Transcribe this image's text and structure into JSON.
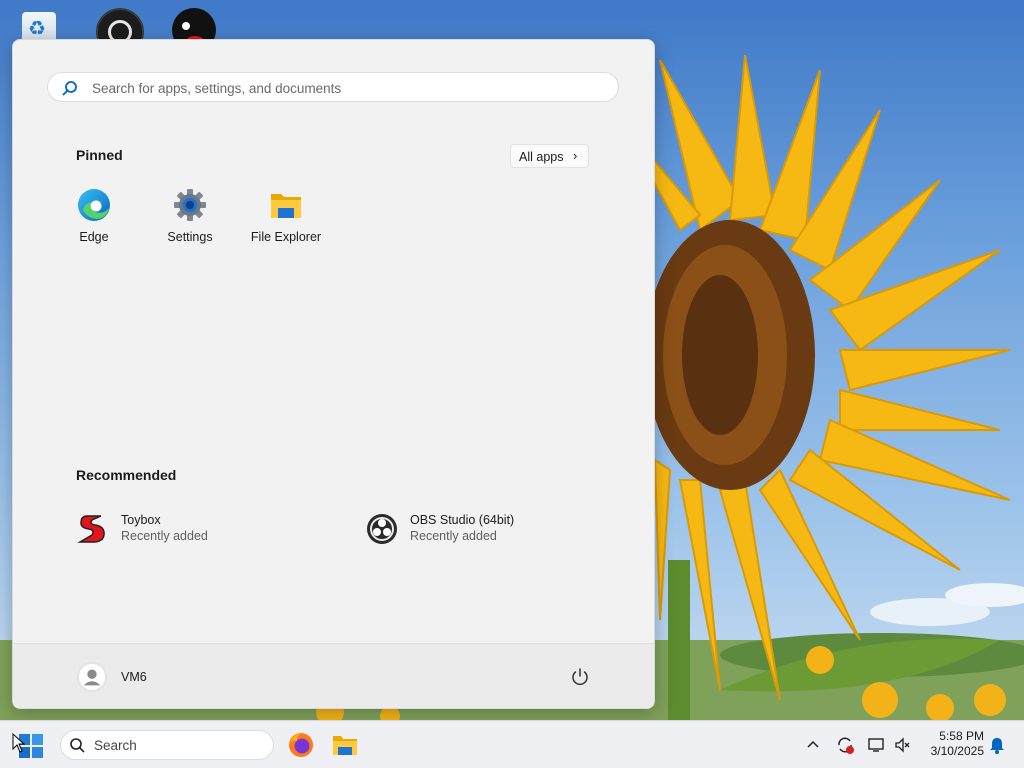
{
  "desktop": {
    "icons": [
      {
        "name": "recycle-bin-icon"
      },
      {
        "name": "obs-studio-icon"
      },
      {
        "name": "toybox-penguin-icon"
      }
    ]
  },
  "start_menu": {
    "search": {
      "placeholder": "Search for apps, settings, and documents"
    },
    "pinned": {
      "title": "Pinned",
      "all_apps_label": "All apps",
      "apps": [
        {
          "label": "Edge",
          "icon": "edge-icon"
        },
        {
          "label": "Settings",
          "icon": "settings-gear-icon"
        },
        {
          "label": "File Explorer",
          "icon": "folder-icon"
        }
      ]
    },
    "recommended": {
      "title": "Recommended",
      "items": [
        {
          "name": "Toybox",
          "subtitle": "Recently added",
          "icon": "toybox-icon"
        },
        {
          "name": "OBS Studio (64bit)",
          "subtitle": "Recently added",
          "icon": "obs-icon"
        }
      ]
    },
    "footer": {
      "user_name": "VM6"
    }
  },
  "taskbar": {
    "search_label": "Search",
    "apps": [
      {
        "name": "firefox-icon"
      },
      {
        "name": "file-explorer-icon"
      }
    ],
    "clock": {
      "time": "5:58 PM",
      "date": "3/10/2025"
    }
  },
  "colors": {
    "accent": "#0067c0",
    "menu_bg": "#f2f2f2",
    "taskbar_bg": "#eef0f3"
  }
}
